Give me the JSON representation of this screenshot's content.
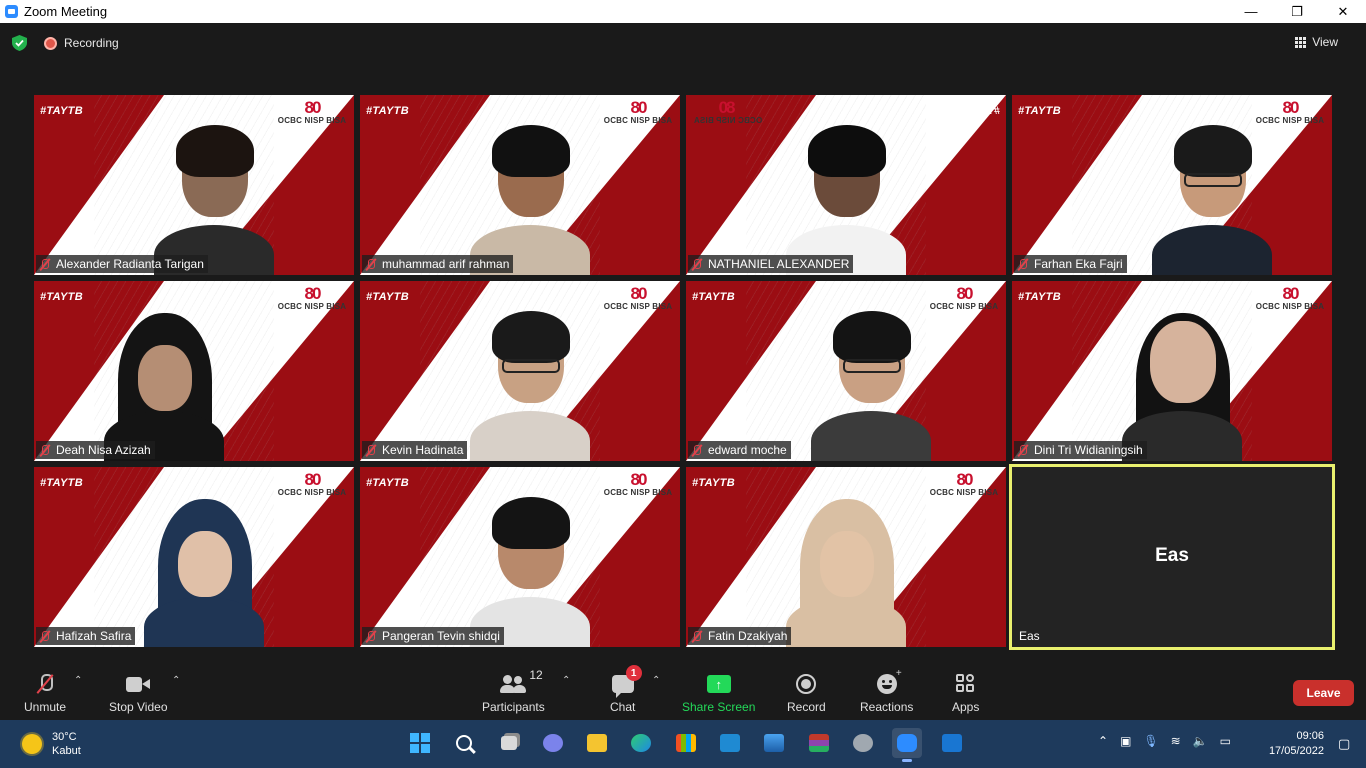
{
  "window": {
    "title": "Zoom Meeting",
    "controls": [
      "—",
      "❐",
      "✕"
    ]
  },
  "topbar": {
    "recording_label": "Recording",
    "view_label": "View"
  },
  "tile_branding": {
    "hashtag": "#TAYTB",
    "logo": "80",
    "brand_text": "OCBC NISP BISA"
  },
  "participants": [
    {
      "name": "Alexander Radianta Tarigan",
      "muted": true
    },
    {
      "name": "muhammad arif rahman",
      "muted": true
    },
    {
      "name": "NATHANIEL ALEXANDER",
      "muted": true
    },
    {
      "name": "Farhan Eka Fajri",
      "muted": true
    },
    {
      "name": "Deah Nisa Azizah",
      "muted": true
    },
    {
      "name": "Kevin Hadinata",
      "muted": true
    },
    {
      "name": "edward moche",
      "muted": true
    },
    {
      "name": "Dini Tri Widianingsih",
      "muted": true
    },
    {
      "name": "Hafizah Safira",
      "muted": true
    },
    {
      "name": "Pangeran Tevin shidqi",
      "muted": true
    },
    {
      "name": "Fatin Dzakiyah",
      "muted": true
    },
    {
      "name": "Eas",
      "muted": false,
      "avatar_text": "Eas",
      "active_speaker": true
    }
  ],
  "toolbar": {
    "unmute": "Unmute",
    "stop_video": "Stop Video",
    "participants": "Participants",
    "participants_count": "12",
    "chat": "Chat",
    "chat_badge": "1",
    "share_screen": "Share Screen",
    "record": "Record",
    "reactions": "Reactions",
    "apps": "Apps",
    "leave": "Leave"
  },
  "taskbar": {
    "weather_temp": "30°C",
    "weather_desc": "Kabut",
    "time": "09:06",
    "date": "17/05/2022"
  },
  "colors": {
    "accent_green": "#23d959",
    "leave_red": "#c9302c",
    "speaker_border": "#e9f06e",
    "tile_red": "#9b0d13"
  }
}
